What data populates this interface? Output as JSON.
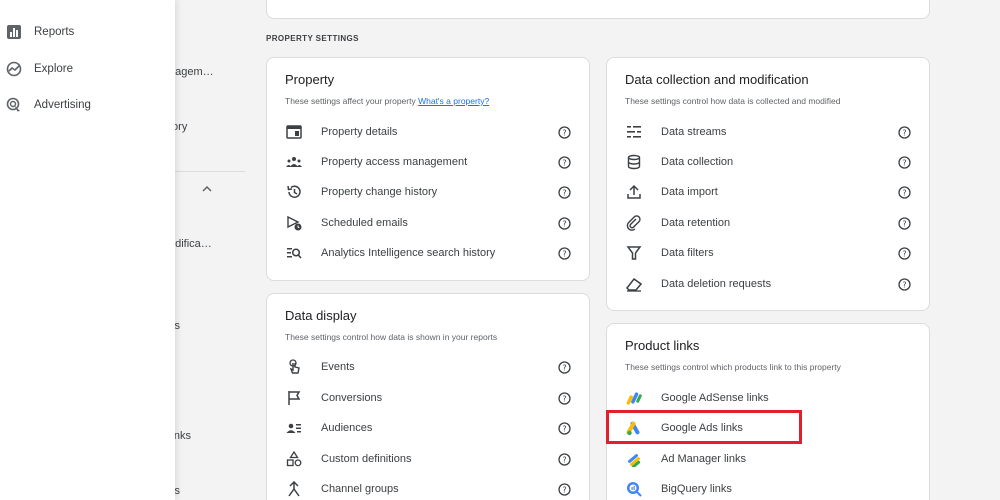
{
  "nav": {
    "items": [
      {
        "label": "Reports",
        "icon": "bar-chart-icon"
      },
      {
        "label": "Explore",
        "icon": "explore-icon"
      },
      {
        "label": "Advertising",
        "icon": "advertising-icon"
      }
    ]
  },
  "bg_nav": {
    "fragments": [
      "nagem…",
      "tory",
      "odifica…",
      "ks",
      "links",
      "ks"
    ]
  },
  "section_label": "PROPERTY SETTINGS",
  "cards": {
    "property": {
      "title": "Property",
      "desc": "These settings affect your property",
      "desc_link": "What's a property?",
      "items": [
        {
          "label": "Property details",
          "icon": "property-details-icon"
        },
        {
          "label": "Property access management",
          "icon": "people-icon"
        },
        {
          "label": "Property change history",
          "icon": "history-icon"
        },
        {
          "label": "Scheduled emails",
          "icon": "scheduled-email-icon"
        },
        {
          "label": "Analytics Intelligence search history",
          "icon": "search-history-icon"
        }
      ]
    },
    "data_collection": {
      "title": "Data collection and modification",
      "desc": "These settings control how data is collected and modified",
      "items": [
        {
          "label": "Data streams",
          "icon": "data-streams-icon"
        },
        {
          "label": "Data collection",
          "icon": "database-icon"
        },
        {
          "label": "Data import",
          "icon": "upload-icon"
        },
        {
          "label": "Data retention",
          "icon": "paperclip-icon"
        },
        {
          "label": "Data filters",
          "icon": "filter-icon"
        },
        {
          "label": "Data deletion requests",
          "icon": "eraser-icon"
        }
      ]
    },
    "data_display": {
      "title": "Data display",
      "desc": "These settings control how data is shown in your reports",
      "items": [
        {
          "label": "Events",
          "icon": "touch-icon"
        },
        {
          "label": "Conversions",
          "icon": "flag-icon"
        },
        {
          "label": "Audiences",
          "icon": "audience-icon"
        },
        {
          "label": "Custom definitions",
          "icon": "shapes-icon"
        },
        {
          "label": "Channel groups",
          "icon": "channel-groups-icon"
        }
      ]
    },
    "product_links": {
      "title": "Product links",
      "desc": "These settings control which products link to this property",
      "items": [
        {
          "label": "Google AdSense links",
          "icon": "adsense-icon"
        },
        {
          "label": "Google Ads links",
          "icon": "google-ads-icon"
        },
        {
          "label": "Ad Manager links",
          "icon": "ad-manager-icon"
        },
        {
          "label": "BigQuery links",
          "icon": "bigquery-icon"
        }
      ]
    }
  },
  "colors": {
    "highlight": "#e0202e",
    "link": "#1a73e8",
    "card_border": "#dadce0"
  }
}
